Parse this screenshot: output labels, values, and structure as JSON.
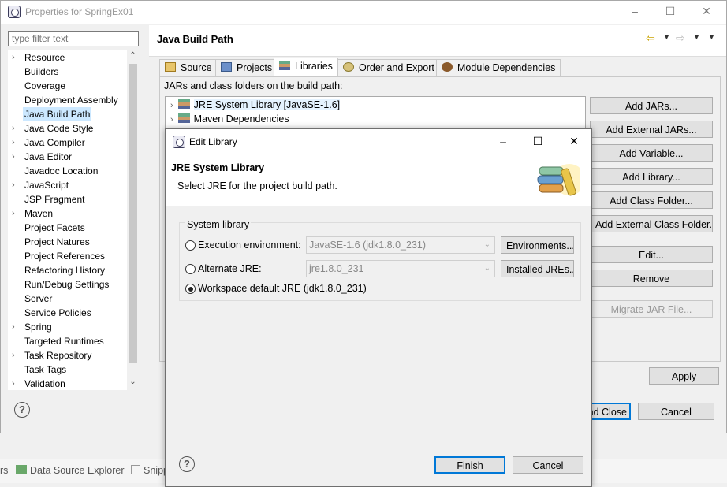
{
  "properties_window": {
    "title": "Properties for SpringEx01",
    "filter_placeholder": "type filter text",
    "tree": [
      {
        "label": "Resource",
        "expandable": true
      },
      {
        "label": "Builders",
        "expandable": false
      },
      {
        "label": "Coverage",
        "expandable": false
      },
      {
        "label": "Deployment Assembly",
        "expandable": false
      },
      {
        "label": "Java Build Path",
        "expandable": false,
        "selected": true
      },
      {
        "label": "Java Code Style",
        "expandable": true
      },
      {
        "label": "Java Compiler",
        "expandable": true
      },
      {
        "label": "Java Editor",
        "expandable": true
      },
      {
        "label": "Javadoc Location",
        "expandable": false
      },
      {
        "label": "JavaScript",
        "expandable": true
      },
      {
        "label": "JSP Fragment",
        "expandable": false
      },
      {
        "label": "Maven",
        "expandable": true
      },
      {
        "label": "Project Facets",
        "expandable": false
      },
      {
        "label": "Project Natures",
        "expandable": false
      },
      {
        "label": "Project References",
        "expandable": false
      },
      {
        "label": "Refactoring History",
        "expandable": false
      },
      {
        "label": "Run/Debug Settings",
        "expandable": false
      },
      {
        "label": "Server",
        "expandable": false
      },
      {
        "label": "Service Policies",
        "expandable": false
      },
      {
        "label": "Spring",
        "expandable": true
      },
      {
        "label": "Targeted Runtimes",
        "expandable": false
      },
      {
        "label": "Task Repository",
        "expandable": true
      },
      {
        "label": "Task Tags",
        "expandable": false
      },
      {
        "label": "Validation",
        "expandable": true
      }
    ],
    "page_title": "Java Build Path",
    "tabs": [
      "Source",
      "Projects",
      "Libraries",
      "Order and Export",
      "Module Dependencies"
    ],
    "active_tab": "Libraries",
    "build_path_label": "JARs and class folders on the build path:",
    "libraries": [
      {
        "label": "JRE System Library [JavaSE-1.6]",
        "selected": true
      },
      {
        "label": "Maven Dependencies",
        "selected": false
      }
    ],
    "side_buttons": {
      "add_jars": "Add JARs...",
      "add_external_jars": "Add External JARs...",
      "add_variable": "Add Variable...",
      "add_library": "Add Library...",
      "add_class_folder": "Add Class Folder...",
      "add_external_class_folder": "Add External Class Folder...",
      "edit": "Edit...",
      "remove": "Remove",
      "migrate_jar": "Migrate JAR File..."
    },
    "apply_label": "Apply",
    "apply_close_visible": "nd Close",
    "cancel_label": "Cancel"
  },
  "views_strip": {
    "left_fragment": "rs",
    "data_source_explorer": "Data Source Explorer",
    "snippets_fragment": "Snipp"
  },
  "edit_library_dialog": {
    "title": "Edit Library",
    "heading": "JRE System Library",
    "description": "Select JRE for the project build path.",
    "group_label": "System library",
    "options": {
      "execution_env": {
        "label": "Execution environment:",
        "value": "JavaSE-1.6 (jdk1.8.0_231)",
        "button": "Environments..."
      },
      "alternate_jre": {
        "label": "Alternate JRE:",
        "value": "jre1.8.0_231",
        "button": "Installed JREs..."
      },
      "workspace_default": {
        "label": "Workspace default JRE (jdk1.8.0_231)"
      }
    },
    "selected_option": "workspace_default",
    "finish_label": "Finish",
    "cancel_label": "Cancel"
  },
  "colors": {
    "selection": "#cce8ff",
    "default_button_border": "#0078d7"
  }
}
